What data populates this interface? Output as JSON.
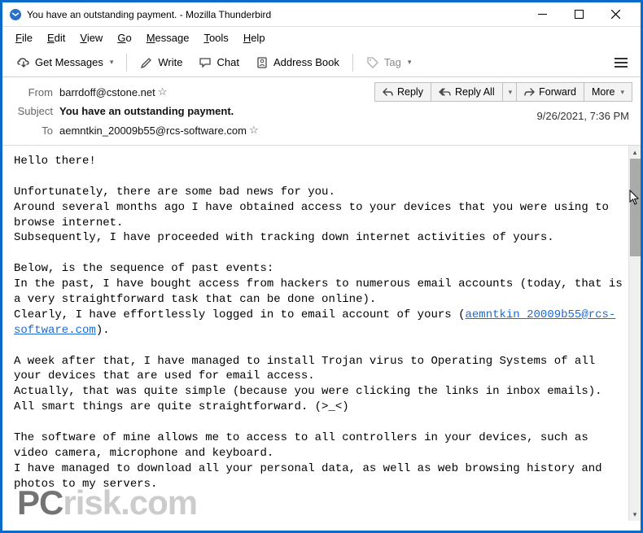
{
  "window": {
    "title": "You have an outstanding payment. - Mozilla Thunderbird"
  },
  "menubar": {
    "file": "File",
    "edit": "Edit",
    "view": "View",
    "go": "Go",
    "message": "Message",
    "tools": "Tools",
    "help": "Help"
  },
  "toolbar": {
    "get_messages": "Get Messages",
    "write": "Write",
    "chat": "Chat",
    "address_book": "Address Book",
    "tag": "Tag"
  },
  "headers": {
    "from_label": "From",
    "from_value": "barrdoff@cstone.net",
    "subject_label": "Subject",
    "subject_value": "You have an outstanding payment.",
    "to_label": "To",
    "to_value": "aemntkin_20009b55@rcs-software.com",
    "date": "9/26/2021, 7:36 PM",
    "reply": "Reply",
    "reply_all": "Reply All",
    "forward": "Forward",
    "more": "More"
  },
  "body": {
    "p1": "Hello there!",
    "p2a": "Unfortunately, there are some bad news for you.",
    "p2b": "Around several months ago I have obtained access to your devices that you were using to browse internet.",
    "p2c": "Subsequently, I have proceeded with tracking down internet activities of yours.",
    "p3a": "Below, is the sequence of past events:",
    "p3b": "In the past, I have bought access from hackers to numerous email accounts (today, that is a very straightforward task that can be done online).",
    "p3c": "Clearly, I have effortlessly logged in to email account of yours (",
    "p3d_link": "aemntkin_20009b55@rcs-software.com",
    "p3e": ").",
    "p4a": "A week after that, I have managed to install Trojan virus to Operating Systems of all your devices that are used for email access.",
    "p4b": "Actually, that was quite simple (because you were clicking the links in inbox emails).",
    "p4c": "All smart things are quite straightforward. (>_<)",
    "p5a": "The software of mine allows me to access to all controllers in your devices, such as video camera, microphone and keyboard.",
    "p5b": "I have managed to download all your personal data, as well as web browsing history and photos to my servers."
  },
  "watermark": {
    "prefix": "PC",
    "suffix": "risk.com"
  }
}
